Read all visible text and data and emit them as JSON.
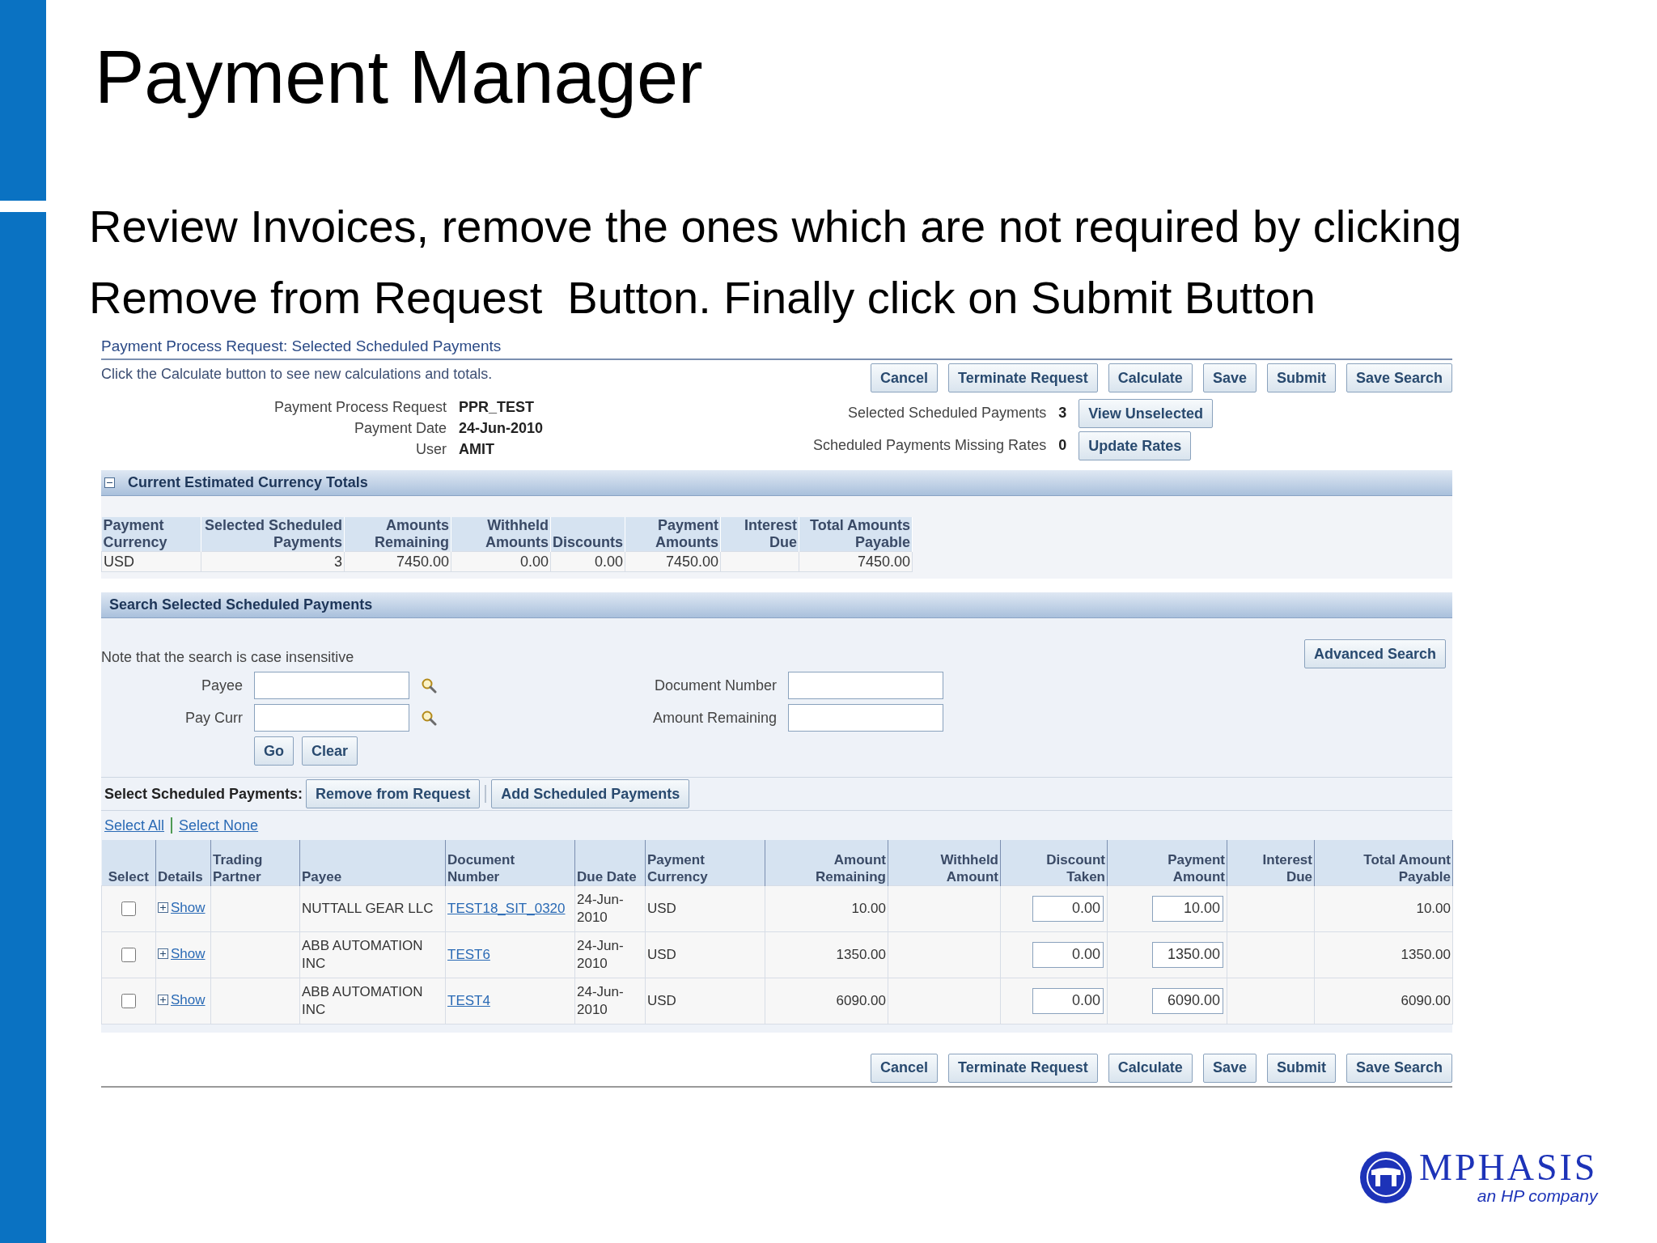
{
  "slide": {
    "title": "Payment Manager",
    "instructions": [
      "Review Invoices, remove the ones which are not required by clicking",
      "Remove from Request  Button. Finally click on Submit Button"
    ]
  },
  "page": {
    "title": "Payment Process Request: Selected Scheduled Payments",
    "hint": "Click the Calculate button to see new calculations and totals.",
    "top_buttons": [
      "Cancel",
      "Terminate Request",
      "Calculate",
      "Save",
      "Submit",
      "Save Search"
    ],
    "info_left": [
      {
        "label": "Payment Process Request",
        "value": "PPR_TEST"
      },
      {
        "label": "Payment Date",
        "value": "24-Jun-2010"
      },
      {
        "label": "User",
        "value": "AMIT"
      }
    ],
    "info_right": [
      {
        "label": "Selected Scheduled Payments",
        "value": "3",
        "button": "View Unselected"
      },
      {
        "label": "Scheduled Payments Missing Rates",
        "value": "0",
        "button": "Update Rates"
      }
    ]
  },
  "totals": {
    "title": "Current Estimated Currency Totals",
    "expanded": true,
    "columns": [
      "Payment\nCurrency",
      "Selected Scheduled\nPayments",
      "Amounts\nRemaining",
      "Withheld\nAmounts",
      "Discounts",
      "Payment\nAmounts",
      "Interest\nDue",
      "Total Amounts\nPayable"
    ],
    "rows": [
      [
        "USD",
        "3",
        "7450.00",
        "0.00",
        "0.00",
        "7450.00",
        "",
        "7450.00"
      ]
    ]
  },
  "search": {
    "title": "Search Selected Scheduled Payments",
    "note": "Note that the search is case insensitive",
    "advanced_button": "Advanced Search",
    "fields": [
      {
        "label": "Payee",
        "lookup": true
      },
      {
        "label": "Document Number",
        "lookup": false
      },
      {
        "label": "Pay Curr",
        "lookup": true
      },
      {
        "label": "Amount Remaining",
        "lookup": false
      }
    ],
    "buttons": [
      "Go",
      "Clear"
    ]
  },
  "selection": {
    "label": "Select Scheduled Payments:",
    "buttons": [
      "Remove from Request",
      "Add Scheduled Payments"
    ],
    "links": [
      "Select All",
      "Select None"
    ]
  },
  "payments": {
    "columns": [
      "Select",
      "Details",
      "Trading\nPartner",
      "Payee",
      "Document\nNumber",
      "Due Date",
      "Payment\nCurrency",
      "Amount\nRemaining",
      "Withheld\nAmount",
      "Discount\nTaken",
      "Payment\nAmount",
      "Interest\nDue",
      "Total Amount\nPayable"
    ],
    "rows": [
      {
        "selected": false,
        "details": "Show",
        "payee": "NUTTALL GEAR LLC",
        "document_number": "TEST18_SIT_0320",
        "due_date": "24-Jun-2010",
        "currency": "USD",
        "amount_remaining": "10.00",
        "discount_taken": "0.00",
        "payment_amount": "10.00",
        "total_payable": "10.00"
      },
      {
        "selected": false,
        "details": "Show",
        "payee": "ABB AUTOMATION INC",
        "document_number": "TEST6",
        "due_date": "24-Jun-2010",
        "currency": "USD",
        "amount_remaining": "1350.00",
        "discount_taken": "0.00",
        "payment_amount": "1350.00",
        "total_payable": "1350.00"
      },
      {
        "selected": false,
        "details": "Show",
        "payee": "ABB AUTOMATION INC",
        "document_number": "TEST4",
        "due_date": "24-Jun-2010",
        "currency": "USD",
        "amount_remaining": "6090.00",
        "discount_taken": "0.00",
        "payment_amount": "6090.00",
        "total_payable": "6090.00"
      }
    ]
  },
  "bottom_buttons": [
    "Cancel",
    "Terminate Request",
    "Calculate",
    "Save",
    "Submit",
    "Save Search"
  ],
  "logo": {
    "name": "MPHASIS",
    "tagline": "an HP company"
  }
}
